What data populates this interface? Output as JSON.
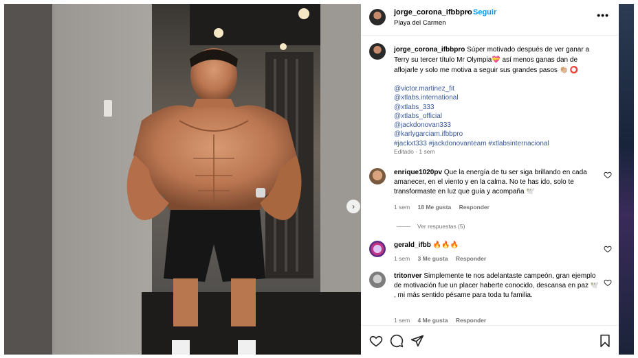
{
  "post": {
    "username": "jorge_corona_ifbbpro",
    "separator": "•",
    "follow_label": "Seguir",
    "location": "Playa del Carmen",
    "more_label": "•••",
    "caption_text": "Súper motivado después de ver ganar a Terry su tercer título Mr Olympia💝 así menos ganas dan de aflojarle y solo me motiva a seguir sus grandes pasos 👏🏼 ⭕",
    "mentions": [
      "@victor.martinez_fit",
      "@xtlabs.international",
      "@xtlabs_333",
      "@xtlabs_official",
      "@jackdonovan333",
      "@karlygarciam.ifbbpro",
      "#jackxt333 #jackdonovanteam #xtlabsinternacional"
    ],
    "edited_label": "Editado · 1 sem"
  },
  "comments": [
    {
      "username": "enrique1020pv",
      "text": "Que la energía de tu ser siga brillando en cada amanecer, en el viento y en la calma. No te has ido, solo te transformaste en luz que guía y acompaña 🕊️",
      "time": "1 sem",
      "likes": "18 Me gusta",
      "reply": "Responder",
      "view_replies": "Ver respuestas (5)"
    },
    {
      "username": "gerald_ifbb",
      "text": "🔥🔥🔥",
      "time": "1 sem",
      "likes": "3 Me gusta",
      "reply": "Responder"
    },
    {
      "username": "tritonver",
      "text": "Simplemente te nos adelantaste campeón, gran ejemplo de motivación fue un placer haberte conocido, descansa en paz 🕊️ , mi más sentido pésame para toda tu familia.",
      "time": "1 sem",
      "likes": "4 Me gusta",
      "reply": "Responder"
    }
  ],
  "icons": {
    "like": "heart-icon",
    "comment": "comment-icon",
    "share": "share-icon",
    "save": "bookmark-icon",
    "next": "chevron-right-icon"
  },
  "colors": {
    "link": "#385898",
    "follow": "#0095f6",
    "meta": "#737373"
  }
}
